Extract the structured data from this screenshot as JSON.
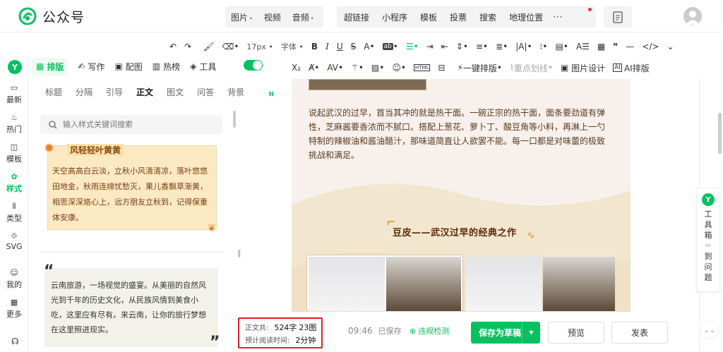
{
  "app": {
    "title": "公众号",
    "brand_color": "#07c160"
  },
  "top_nav": {
    "group1": [
      {
        "label": "图片",
        "dropdown": true
      },
      {
        "label": "视频",
        "dropdown": false
      },
      {
        "label": "音频",
        "dropdown": true
      }
    ],
    "group2": [
      "超链接",
      "小程序",
      "模板",
      "投票",
      "搜索",
      "地理位置"
    ],
    "more": "···"
  },
  "rail": {
    "items": [
      {
        "label": "最新",
        "icon": "message-icon"
      },
      {
        "label": "热门",
        "icon": "flame-icon"
      },
      {
        "label": "模板",
        "icon": "template-icon"
      },
      {
        "label": "样式",
        "icon": "palette-icon",
        "active": true
      },
      {
        "label": "类型",
        "icon": "columns-icon"
      },
      {
        "label": "SVG",
        "icon": "svg-icon"
      },
      {
        "label": "我的",
        "icon": "user-icon"
      },
      {
        "label": "更多",
        "icon": "grid-icon"
      }
    ],
    "logo": "Y"
  },
  "panel": {
    "tabs": [
      {
        "label": "排版",
        "icon": "layout-icon",
        "active": true
      },
      {
        "label": "写作",
        "icon": "pen-icon"
      },
      {
        "label": "配图",
        "icon": "image-icon"
      },
      {
        "label": "热榜",
        "icon": "bars-icon"
      },
      {
        "label": "工具",
        "icon": "cube-icon"
      }
    ],
    "categories": [
      "标题",
      "分隔",
      "引导",
      "正文",
      "图文",
      "问答",
      "背景"
    ],
    "active_category": "正文",
    "search_placeholder": "输入样式关键词搜索",
    "card1": {
      "title": "风轻轻叶黄黄",
      "text": "天空高高白云淡，立秋小风清清凉，落叶悠悠田地金，秋雨连绵忧愁灭，果儿香飘草渐黄，相思深深烙心上，远方朋友立秋到，记得保重体安康。"
    },
    "card2": {
      "open_quote": "“",
      "text": "云南旅游，一场视觉的盛宴。从美丽的自然风光到千年的历史文化，从民族风情到美食小吃，这里应有尽有。来云南，让你的旅行梦想在这里照进现实。",
      "close_quote": "”"
    }
  },
  "toolbar": {
    "font_size": "17px",
    "font_family": "字体",
    "one_click": "一键排版",
    "highlight": "重点划线",
    "image_design": "图片设计",
    "ai_layout": "AI排版"
  },
  "article": {
    "paragraph": "说起武汉的过早，首当其冲的就是热干面。一碗正宗的热干面，面条要劲道有弹性，芝麻酱要香浓而不腻口。搭配上葱花、萝卜丁、酸豆角等小料，再淋上一勺特制的辣椒油和酱油醋汁，那味道简直让人欲罢不能。每一口都是对味蕾的极致挑战和满足。",
    "heading": "豆皮——武汉过早的经典之作"
  },
  "right": {
    "toolbox": "工具箱",
    "to_question": "到问题"
  },
  "bottom": {
    "stats": {
      "total_label": "正文共:",
      "word_count": "524字",
      "image_count": "23图",
      "read_label": "预计阅读时间:",
      "read_time": "2分钟"
    },
    "saved_time": "09:46",
    "saved_label": "已保存",
    "check_label": "违规检测",
    "save_draft": "保存为草稿",
    "preview": "预览",
    "publish": "发表"
  }
}
